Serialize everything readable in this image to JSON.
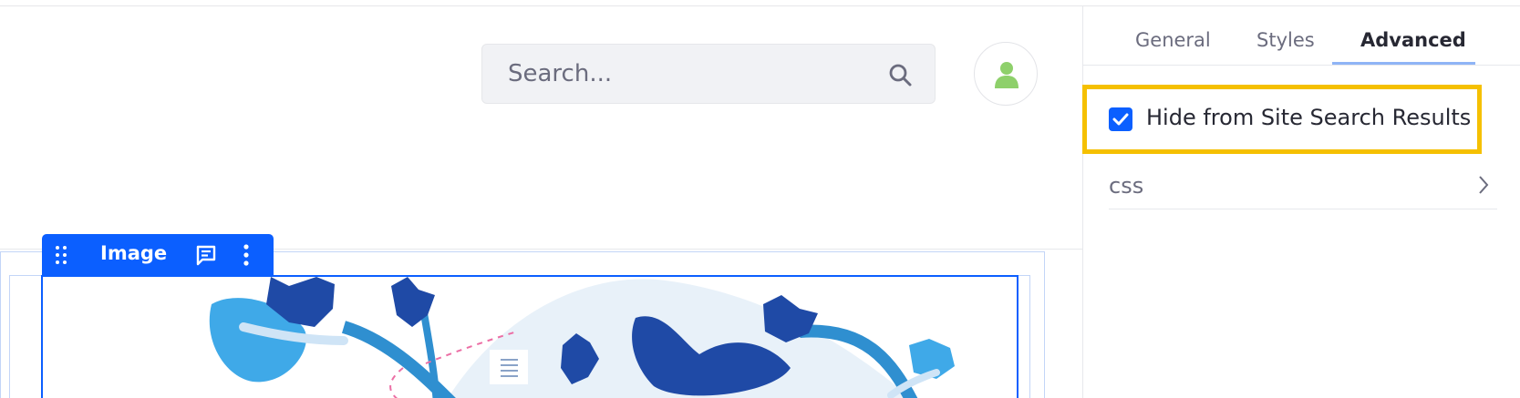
{
  "header": {
    "search": {
      "placeholder": "Search..."
    },
    "avatar_color": "#8ed06b"
  },
  "fragment": {
    "topper_label": "Image"
  },
  "panel": {
    "tabs": [
      {
        "label": "General",
        "active": false
      },
      {
        "label": "Styles",
        "active": false
      },
      {
        "label": "Advanced",
        "active": true
      }
    ],
    "hide_from_search": {
      "label": "Hide from Site Search Results",
      "checked": true
    },
    "css_section": {
      "label": "css"
    }
  },
  "colors": {
    "accent": "#0b5fff",
    "highlight": "#f5c000",
    "illustration_dark": "#1f4aa6",
    "illustration_light": "#3fa9e8"
  },
  "icons": [
    "search-icon",
    "user-icon",
    "drag-handle-icon",
    "comment-icon",
    "kebab-icon",
    "check-icon",
    "chevron-right-icon"
  ]
}
